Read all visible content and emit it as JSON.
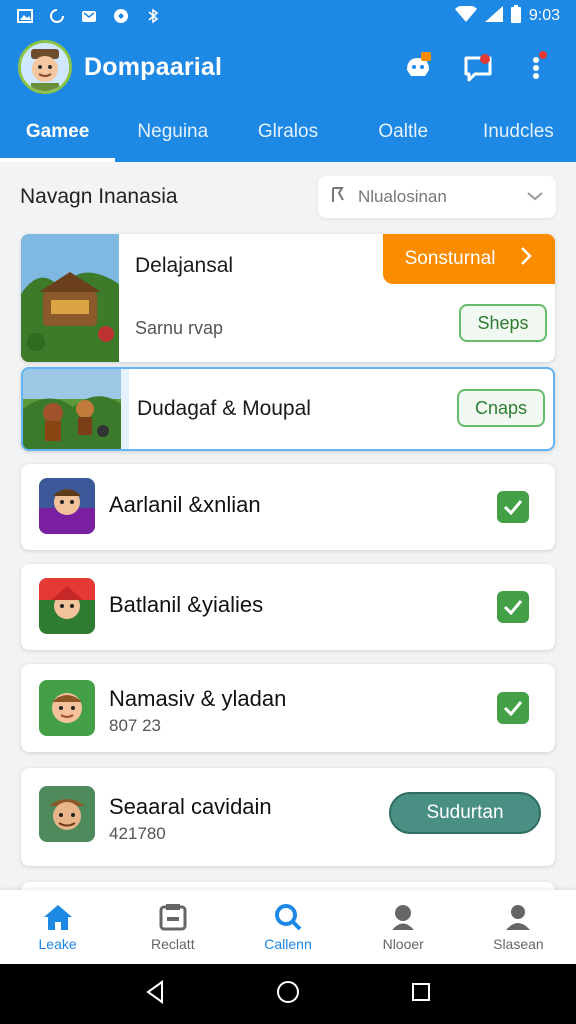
{
  "status_bar": {
    "time": "9:03",
    "icons": [
      "gallery-icon",
      "sync-icon",
      "mail-icon",
      "chat-icon",
      "bluetooth-icon",
      "wifi-icon",
      "signal-icon",
      "battery-icon"
    ]
  },
  "app_bar": {
    "title": "Dompaarial",
    "actions": [
      "badge-icon",
      "chat-alert-icon",
      "more-vert-icon"
    ]
  },
  "tabs": [
    {
      "label": "Gamee",
      "active": true
    },
    {
      "label": "Neguina",
      "active": false
    },
    {
      "label": "Glralos",
      "active": false
    },
    {
      "label": "Oaltle",
      "active": false
    },
    {
      "label": "Inudcles",
      "active": false
    }
  ],
  "section": {
    "title": "Navagn Inanasia",
    "sort_label": "Nlualosinan"
  },
  "featured": [
    {
      "title": "Delajansal",
      "subtitle": "Sarnu rvap",
      "primary_action": "Sonsturnal",
      "secondary_action": "Sheps"
    },
    {
      "title": "Dudagaf & Moupal",
      "secondary_action": "Cnaps"
    }
  ],
  "list": [
    {
      "title": "Aarlanil &xnlian",
      "subtitle": "",
      "checked": true
    },
    {
      "title": "Batlanil &yialies",
      "subtitle": "",
      "checked": true
    },
    {
      "title": "Namasiv & yladan",
      "subtitle": "807 23",
      "checked": true
    },
    {
      "title": "Seaaral cavidain",
      "subtitle": "421780",
      "action": "Sudurtan"
    }
  ],
  "bottom_nav": [
    {
      "label": "Leake",
      "icon": "home-icon",
      "active": true
    },
    {
      "label": "Reclatt",
      "icon": "inbox-icon",
      "active": false
    },
    {
      "label": "Callenn",
      "icon": "search-icon",
      "active": false
    },
    {
      "label": "Nlooer",
      "icon": "person-group-icon",
      "active": false
    },
    {
      "label": "Slasean",
      "icon": "profile-icon",
      "active": false
    }
  ],
  "colors": {
    "primary": "#1e88e5",
    "accent_orange": "#fb8c00",
    "success": "#43a047",
    "teal": "#4a8f84"
  }
}
